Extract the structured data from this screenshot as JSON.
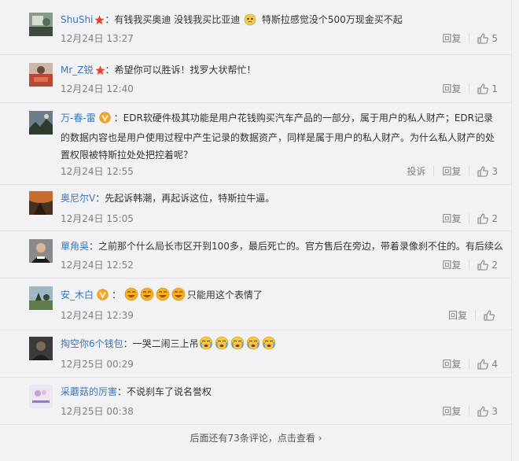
{
  "comments": [
    {
      "user": "ShuShi",
      "badge": "star",
      "text_a": "：有钱我买奥迪 没钱我买比亚迪",
      "text_b": "特斯拉感觉没个500万现金买不起",
      "time": "12月24日 13:27",
      "reply_label": "回复",
      "likes": "5"
    },
    {
      "user": "Mr_Z锐",
      "badge": "star",
      "text": "：希望你可以胜诉！找罗大状帮忙！",
      "time": "12月24日 12:40",
      "reply_label": "回复",
      "likes": "1"
    },
    {
      "user": "万-春-雷",
      "badge": "v-gold",
      "text": "：EDR软硬件极其功能是用户花钱购买汽车产品的一部分，属于用户的私人财产；EDR记录的数据内容也是用户使用过程中产生记录的数据资产，同样是属于用户的私人财产。为什么私人财产的处置权限被特斯拉处处把控着呢？",
      "time": "12月24日 12:55",
      "report_label": "投诉",
      "reply_label": "回复",
      "likes": "3"
    },
    {
      "user": "奥尼尔V",
      "text": "：先起诉韩潮，再起诉这位，特斯拉牛逼。",
      "time": "12月24日 15:05",
      "reply_label": "回复",
      "likes": "2"
    },
    {
      "user": "單角吳",
      "text": "：之前那个什么局长市区开到100多，最后死亡的。官方售后在旁边，带着录像刹不住的。有后续么",
      "time": "12月24日 12:52",
      "reply_label": "回复",
      "likes": "2"
    },
    {
      "user": "安_木白",
      "badge": "v-gold",
      "text": "只能用这个表情了",
      "time": "12月24日 12:39",
      "reply_label": "回复",
      "likes": ""
    },
    {
      "user": "掏空你6个钱包",
      "text": "：一哭二闹三上吊",
      "time": "12月25日 00:29",
      "reply_label": "回复",
      "likes": "4"
    },
    {
      "user": "采蘑菇的厉害",
      "text": "：不说刹车了说名誉权",
      "time": "12月25日 00:38",
      "reply_label": "回复",
      "likes": "3"
    }
  ],
  "footer": {
    "more_label": "后面还有73条评论，点击查看 ›"
  },
  "colors": {
    "username": "#3b75b8",
    "meta": "#808080",
    "background": "#f2f2f5"
  }
}
